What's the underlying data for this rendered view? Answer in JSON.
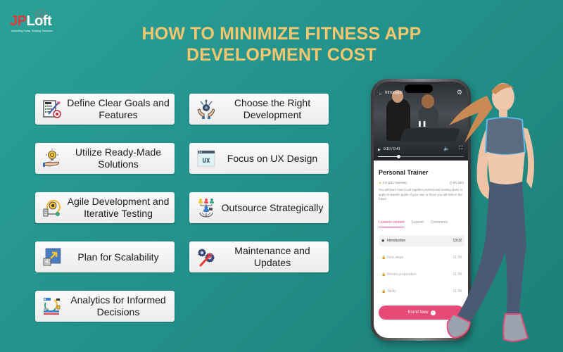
{
  "logo": {
    "brand_part1": "JP",
    "brand_part2": "Loft",
    "tagline": "Innovating Today, Shaping Tomorrow"
  },
  "title": {
    "line1": "HOW TO MINIMIZE FITNESS APP",
    "line2": "DEVELOPMENT COST"
  },
  "cards": [
    {
      "label": "Define Clear Goals and Features",
      "icon": "goals-checklist-icon"
    },
    {
      "label": "Choose the Right Development",
      "icon": "hands-gear-icon"
    },
    {
      "label": "Utilize Ready-Made Solutions",
      "icon": "lightbulb-hand-icon"
    },
    {
      "label": "Focus on UX Design",
      "icon": "ux-window-icon"
    },
    {
      "label": "Agile Development and Iterative Testing",
      "icon": "agile-cycle-icon"
    },
    {
      "label": "Outsource Strategically",
      "icon": "team-globe-icon"
    },
    {
      "label": "Plan for Scalability",
      "icon": "scale-arrow-icon"
    },
    {
      "label": "Maintenance and Updates",
      "icon": "gears-wrench-icon"
    },
    {
      "label": "Analytics for Informed Decisions",
      "icon": "analytics-chart-icon"
    }
  ],
  "phone": {
    "video": {
      "title": "Introducti",
      "time": "0:10 / 0:41",
      "progress": 0.24
    },
    "course": {
      "title": "Personal Trainer",
      "rating": "4.9 (231 reviews)",
      "duration": "5h 30m",
      "description": "You will learn how to put together professional training plans to apply to specific goals of your own or those you will train in the future."
    },
    "tabs": [
      "Lessons content",
      "Support",
      "Comments"
    ],
    "active_tab": "Lessons content",
    "lessons": [
      {
        "name": "Introduction",
        "time": "13:02",
        "state": "playing"
      },
      {
        "name": "First steps",
        "time": "21:39",
        "state": "locked"
      },
      {
        "name": "Mental preperation",
        "time": "21:39",
        "state": "locked"
      },
      {
        "name": "Tactis",
        "time": "21:39",
        "state": "locked"
      }
    ],
    "enroll_label": "Enroll Now"
  },
  "colors": {
    "background": "#23928b",
    "title": "#f7c66e",
    "accent_pink": "#e84a78",
    "logo_red": "#e23b3b"
  }
}
